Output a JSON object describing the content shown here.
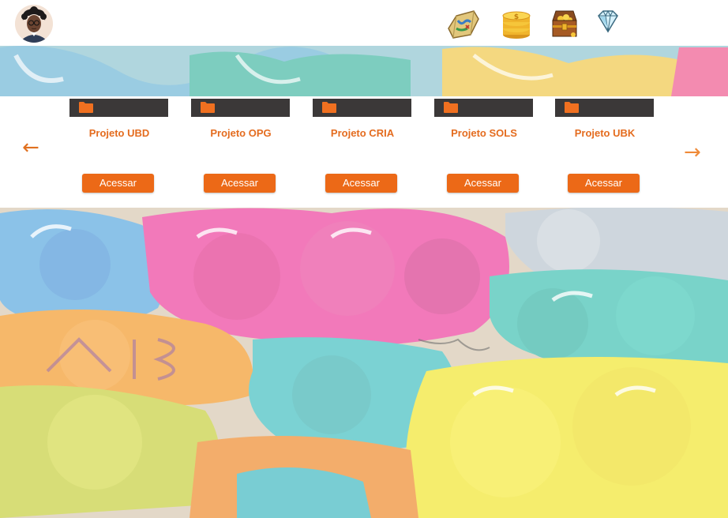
{
  "header": {
    "avatar_icon": "user-avatar-icon",
    "icons": [
      "treasure-map-icon",
      "gold-coins-icon",
      "treasure-chest-icon",
      "diamond-icon"
    ]
  },
  "carousel": {
    "prev_arrow": "←",
    "next_arrow": "→",
    "projects": [
      {
        "title": "Projeto UBD",
        "button": "Acessar"
      },
      {
        "title": "Projeto OPG",
        "button": "Acessar"
      },
      {
        "title": "Projeto CRIA",
        "button": "Acessar"
      },
      {
        "title": "Projeto SOLS",
        "button": "Acessar"
      },
      {
        "title": "Projeto UBK",
        "button": "Acessar"
      }
    ]
  },
  "colors": {
    "accent": "#ec6917",
    "title": "#e46c1f",
    "card_header": "#3b3838",
    "folder": "#f07020"
  }
}
